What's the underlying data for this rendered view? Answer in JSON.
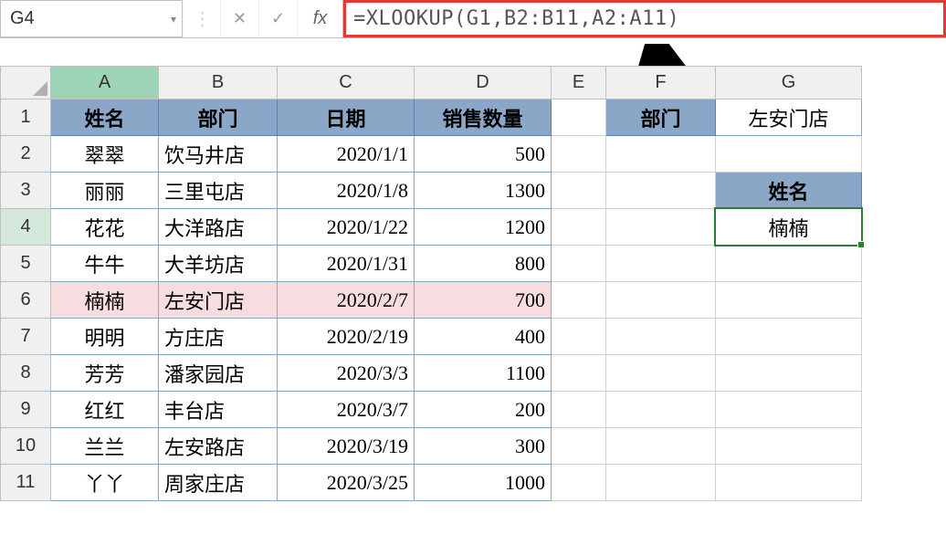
{
  "namebox": "G4",
  "fx_label": "fx",
  "formula": "=XLOOKUP(G1,B2:B11,A2:A11)",
  "col_headers": [
    "A",
    "B",
    "C",
    "D",
    "E",
    "F",
    "G"
  ],
  "row_headers": [
    "1",
    "2",
    "3",
    "4",
    "5",
    "6",
    "7",
    "8",
    "9",
    "10",
    "11"
  ],
  "main_headers": {
    "A": "姓名",
    "B": "部门",
    "C": "日期",
    "D": "销售数量"
  },
  "rows": [
    {
      "name": "翠翠",
      "dept": "饮马井店",
      "date": "2020/1/1",
      "qty": "500",
      "hl": false
    },
    {
      "name": "丽丽",
      "dept": "三里屯店",
      "date": "2020/1/8",
      "qty": "1300",
      "hl": false
    },
    {
      "name": "花花",
      "dept": "大洋路店",
      "date": "2020/1/22",
      "qty": "1200",
      "hl": false
    },
    {
      "name": "牛牛",
      "dept": "大羊坊店",
      "date": "2020/1/31",
      "qty": "800",
      "hl": false
    },
    {
      "name": "楠楠",
      "dept": "左安门店",
      "date": "2020/2/7",
      "qty": "700",
      "hl": true
    },
    {
      "name": "明明",
      "dept": "方庄店",
      "date": "2020/2/19",
      "qty": "400",
      "hl": false
    },
    {
      "name": "芳芳",
      "dept": "潘家园店",
      "date": "2020/3/3",
      "qty": "1100",
      "hl": false
    },
    {
      "name": "红红",
      "dept": "丰台店",
      "date": "2020/3/7",
      "qty": "200",
      "hl": false
    },
    {
      "name": "兰兰",
      "dept": "左安路店",
      "date": "2020/3/19",
      "qty": "300",
      "hl": false
    },
    {
      "name": "丫丫",
      "dept": "周家庄店",
      "date": "2020/3/25",
      "qty": "1000",
      "hl": false
    }
  ],
  "side": {
    "F1_label": "部门",
    "G1_value": "左安门店",
    "G3_label": "姓名",
    "G4_value": "楠楠"
  }
}
